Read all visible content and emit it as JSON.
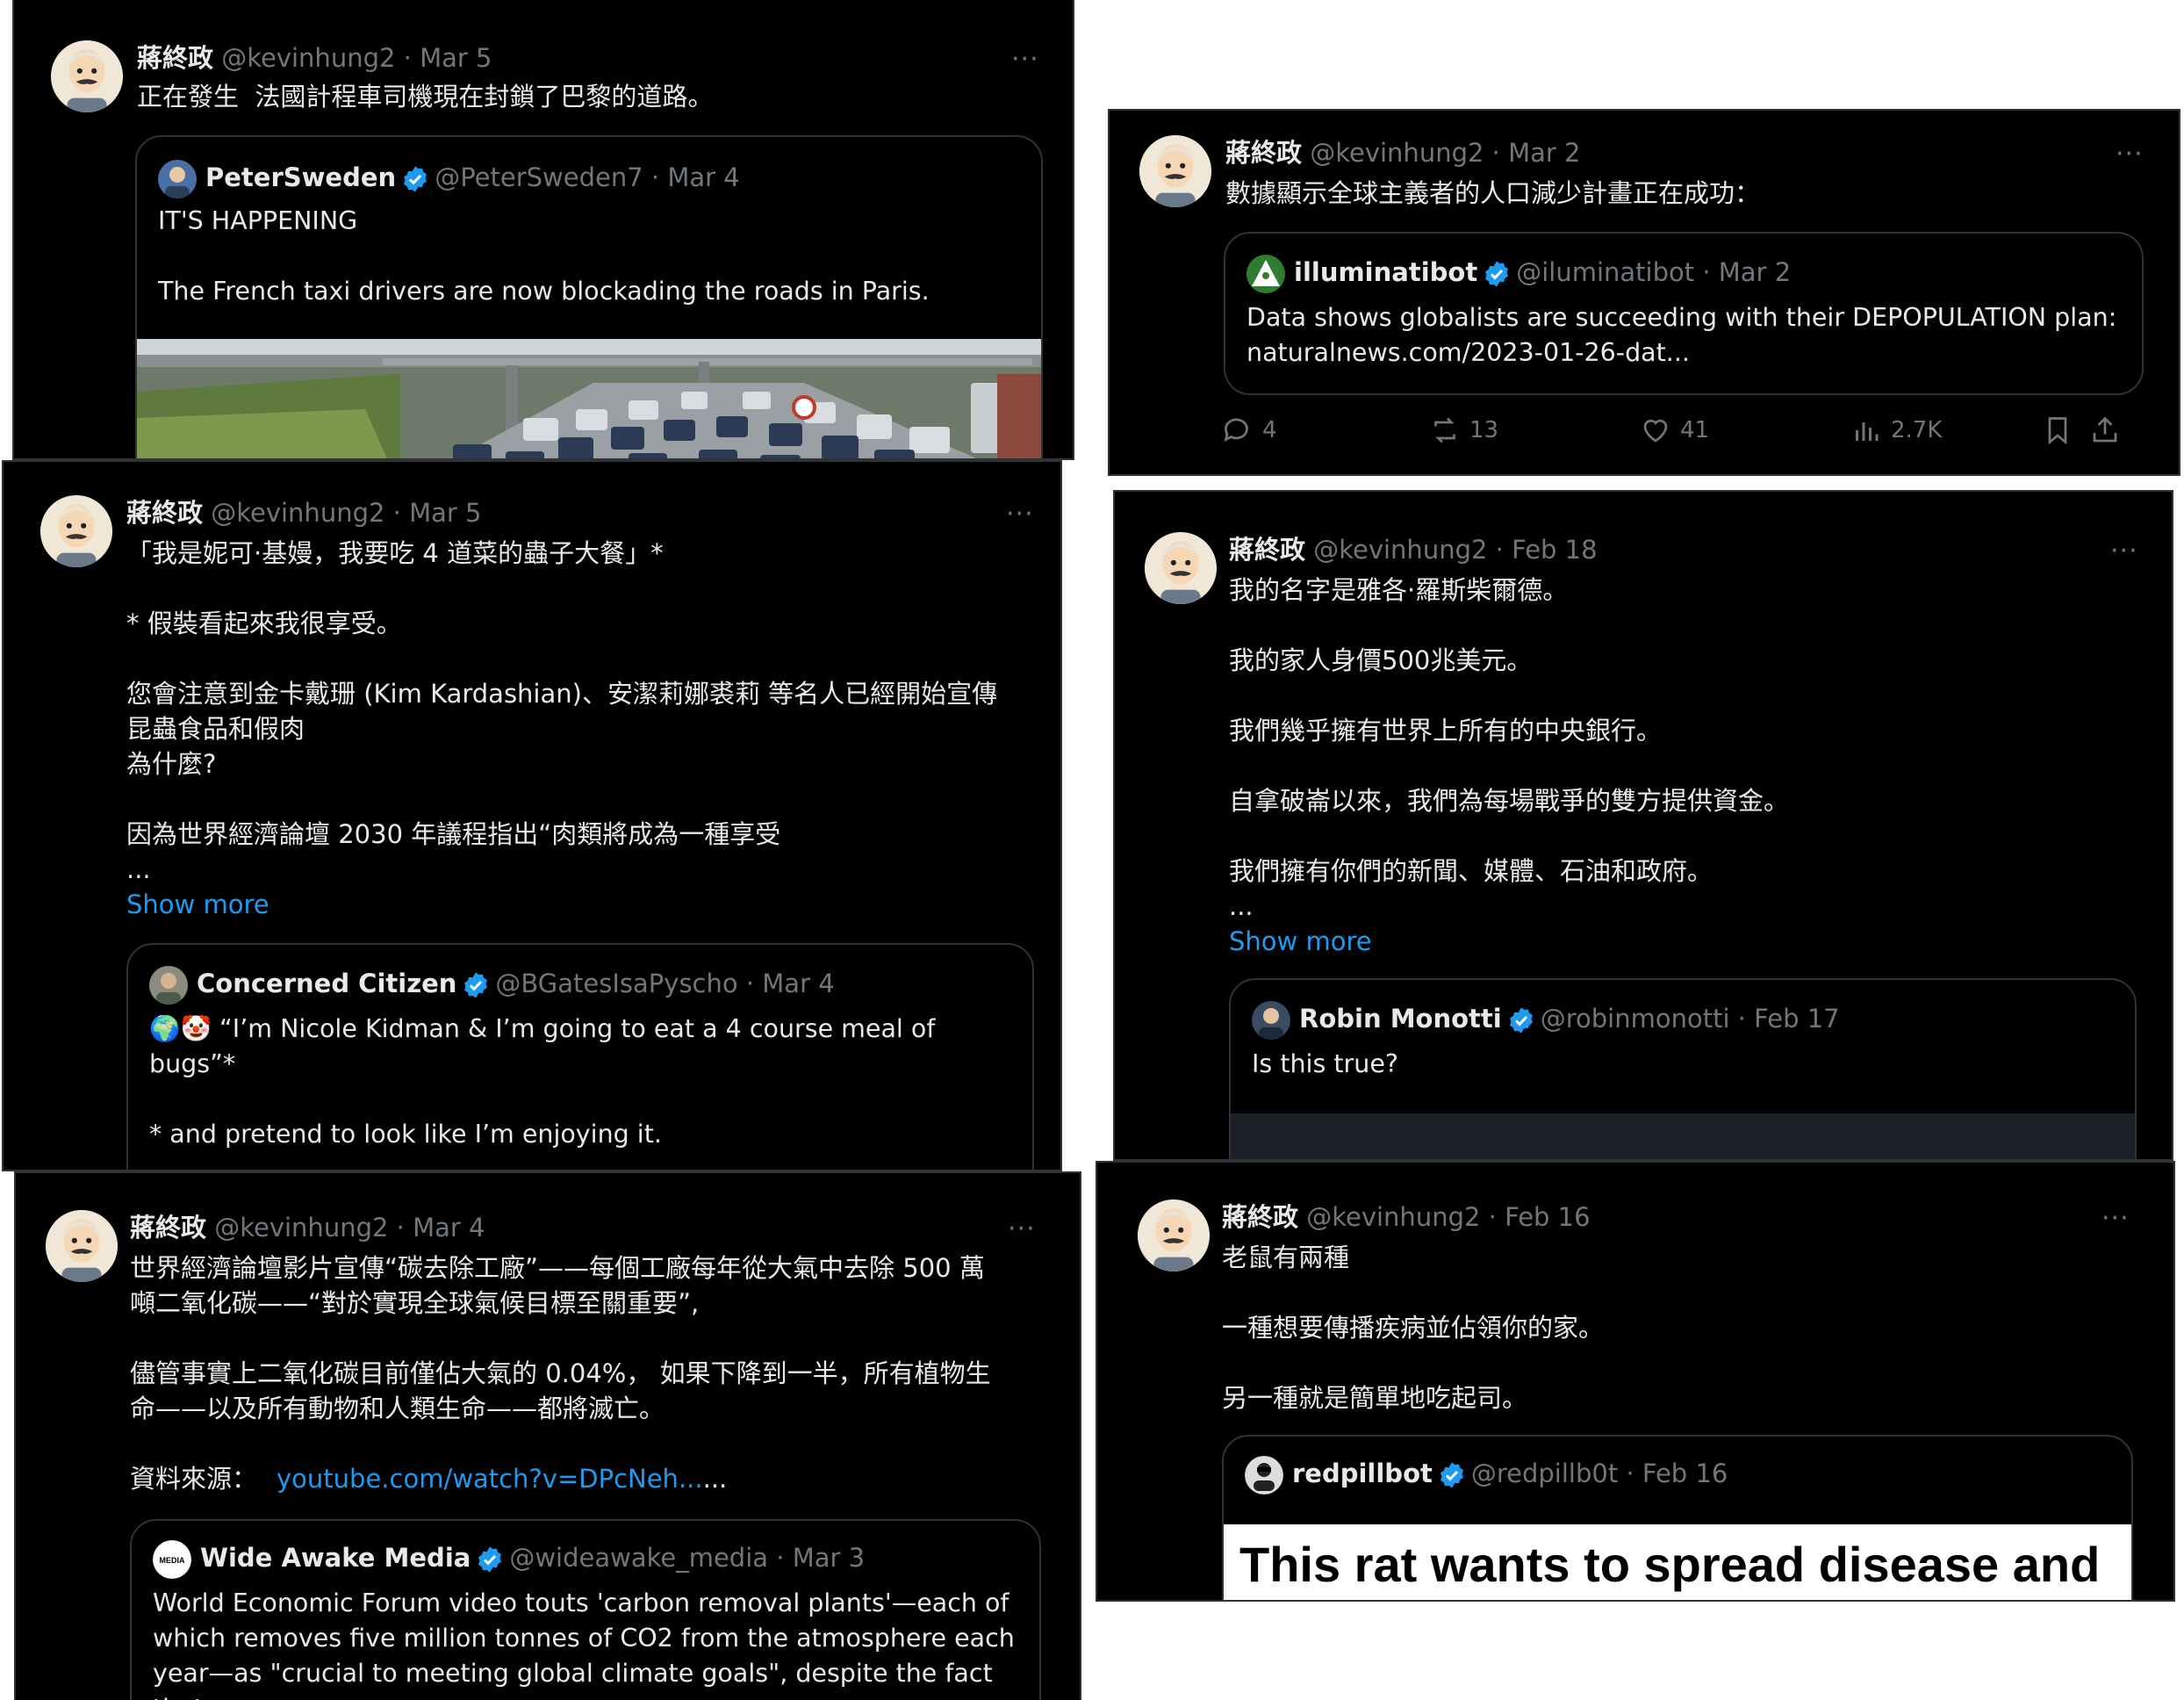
{
  "author": {
    "name": "蔣終政",
    "handle": "@kevinhung2"
  },
  "separator": " · ",
  "more_icon": "···",
  "show_more": "Show more",
  "tweets": [
    {
      "date": "Mar 5",
      "text": "正在發生  法國計程車司機現在封鎖了巴黎的道路。",
      "quote": {
        "name": "PeterSweden",
        "handle": "@PeterSweden7",
        "date": "Mar 4",
        "text": "IT'S HAPPENING\n\nThe French taxi drivers are now blockading the roads in Paris."
      }
    },
    {
      "date": "Mar 2",
      "text": "數據顯示全球主義者的人口減少計畫正在成功：",
      "quote": {
        "name": "illuminatibot",
        "handle": "@iluminatibot",
        "date": "Mar 2",
        "text": "Data shows globalists are succeeding with their DEPOPULATION plan:\nnaturalnews.com/2023-01-26-dat..."
      },
      "stats": {
        "replies": "4",
        "reposts": "13",
        "likes": "41",
        "views": "2.7K"
      }
    },
    {
      "date": "Mar 5",
      "text": "「我是妮可·基嫚，我要吃 4 道菜的蟲子大餐」*\n\n* 假裝看起來我很享受。\n\n您會注意到金卡戴珊 (Kim Kardashian)、安潔莉娜裘莉 等名人已經開始宣傳\n昆蟲食品和假肉\n為什麼?\n\n因為世界經濟論壇 2030 年議程指出“肉類將成為一種享受\n...",
      "quote": {
        "name": "Concerned Citizen",
        "handle": "@BGatesIsaPyscho",
        "date": "Mar 4",
        "text": "🌍🤡 “I’m Nicole Kidman & I’m going to eat a 4 course meal of bugs”*\n\n* and pretend to look like I’m enjoying it.\n\nYou will notice celebrities - Kim Kardashian, Angelina Jolie who are"
      }
    },
    {
      "date": "Feb 18",
      "text": "我的名字是雅各·羅斯柴爾德。\n\n我的家人身價500兆美元。\n\n我們幾乎擁有世界上所有的中央銀行。\n\n自拿破崙以來，我們為每場戰爭的雙方提供資金。\n\n我們擁有你們的新聞、媒體、石油和政府。\n...",
      "quote": {
        "name": "Robin Monotti",
        "handle": "@robinmonotti",
        "date": "Feb 17",
        "text": "Is this true?"
      }
    },
    {
      "date": "Mar 4",
      "text": "世界經濟論壇影片宣傳“碳去除工廠”——每個工廠每年從大氣中去除 500 萬\n噸二氧化碳——“對於實現全球氣候目標至關重要”,\n\n儘管事實上二氧化碳目前僅佔大氣的 0.04%， 如果下降到一半，所有植物生\n命——以及所有動物和人類生命——都將滅亡。\n\n資料來源：",
      "link": "youtube.com/watch?v=DPcNeh...",
      "link_suffix": "...",
      "quote": {
        "name": "Wide Awake Media",
        "handle": "@wideawake_media",
        "date": "Mar 3",
        "text": "World Economic Forum video touts 'carbon removal plants'—each of\nwhich removes five million tonnes of CO2 from the atmosphere each\nyear—as \"crucial to meeting global climate goals\", despite the fact that"
      }
    },
    {
      "date": "Feb 16",
      "text": "老鼠有兩種\n\n一種想要傳播疾病並佔領你的家。\n\n另一種就是簡單地吃起司。",
      "quote": {
        "name": "redpillbot",
        "handle": "@redpillb0t",
        "date": "Feb 16",
        "image_text": "This rat wants to spread disease and"
      }
    }
  ],
  "colors": {
    "bg": "#000000",
    "text": "#e7e9ea",
    "muted": "#71767b",
    "link": "#1d9bf0",
    "border": "#2f3336"
  }
}
